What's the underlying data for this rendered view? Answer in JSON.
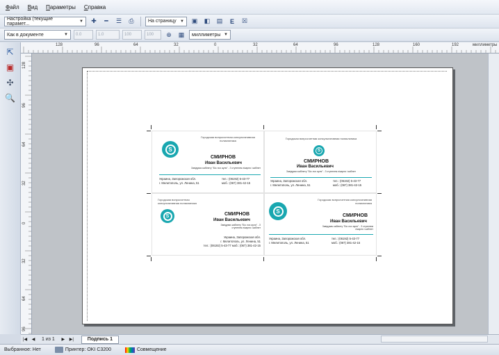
{
  "menu": [
    "Файл",
    "Вид",
    "Параметры",
    "Справка"
  ],
  "toolbar1": {
    "preset": "Настройка (текущие парамет...",
    "page_mode": "На страницу"
  },
  "toolbar2": {
    "scale": "Как в документе",
    "units": "миллиметры"
  },
  "ruler_top_labels": [
    "128",
    "96",
    "64",
    "32",
    "0",
    "32",
    "64",
    "96",
    "128",
    "160",
    "192"
  ],
  "ruler_top_unit": "миллиметры",
  "ruler_left_labels": [
    "128",
    "96",
    "64",
    "32",
    "0",
    "32",
    "64",
    "96"
  ],
  "cards": [
    {
      "org": "Городская вопросчетная консультативная поликлиника",
      "name": "СМИРНОВ",
      "sub": "Иван Васильевич",
      "position": "Завідувач кабінету \"Біо лох ауля\" - З ступенем лікарня і кабінет",
      "address1": "Украина, Запорожская обл.",
      "address2": "г. Мелитополь, ул. Ленина, 51",
      "phone1": "тел.: (06192) 5-43-77",
      "phone2": "моб.: (067) 381-42-15"
    },
    {
      "org": "Городская вопросчетная консультативная поликлиника",
      "name": "СМИРНОВ",
      "sub": "Иван Васильевич",
      "position": "Завідувач кабінету \"Біо лох ауля\" - З ступенем лікарня і кабінет",
      "address1": "Украина, Запорожская обл.",
      "address2": "г. Мелитополь, ул. Ленина, 51",
      "phone1": "тел.: (06192) 5-43-77",
      "phone2": "моб.: (067) 381-42-15"
    },
    {
      "org": "Городская вопросчетная консультативная поликлиника",
      "name": "СМИРНОВ",
      "sub": "Иван Васильевич",
      "position": "Завідувач кабінету \"Біо лох ауля\" - З ступенем лікарня і кабінет",
      "address1": "Украина, Запорожская обл.",
      "address2": "г. Мелитополь, ул. Ленина, 51",
      "phone1": "тел.: (06192) 5-43-77 моб.: (067) 381-42-15",
      "phone2": ""
    },
    {
      "org": "Городская вопросчетная консультативная поликлиника",
      "name": "СМИРНОВ",
      "sub": "Иван Васильевич",
      "position": "Завідувач кабінету \"Біо лох ауля\" - З ступенем лікарня і кабінет",
      "address1": "Украина, Запорожская обл.",
      "address2": "г. Мелитополь, ул. Ленина, 51",
      "phone1": "тел.: (06192) 5-43-77",
      "phone2": "моб.: (067) 381-42-15"
    }
  ],
  "page_nav": {
    "counter": "1 из 1",
    "tab": "Подпись 1"
  },
  "status": {
    "selected": "Выбранное: Нет",
    "printer": "Принтер: OKI C3200",
    "mode": "Совмещение"
  },
  "accent": "#19a7b0"
}
